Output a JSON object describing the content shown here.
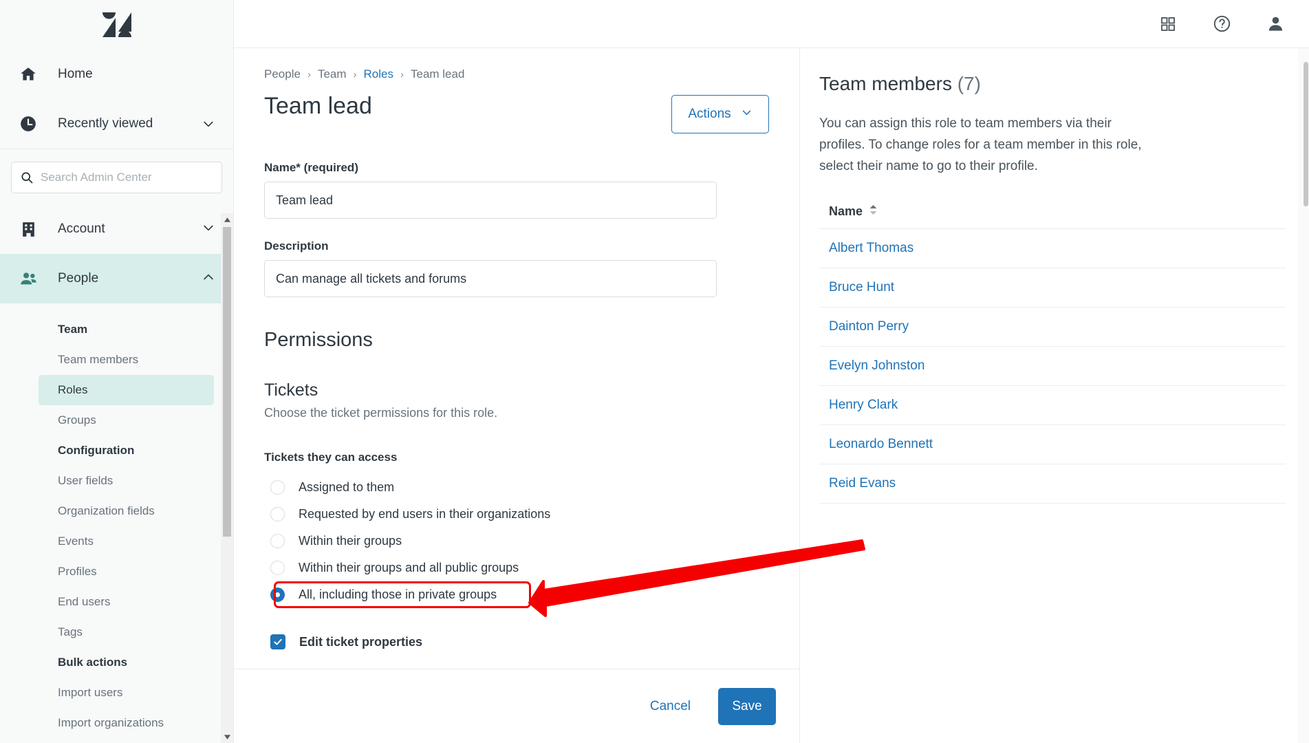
{
  "brand": {
    "logo_name": "zendesk-logo",
    "accent": "#1f73b7",
    "nav_active_bg": "#d7eeea",
    "highlight": "#f50000"
  },
  "sidebar": {
    "top_items": [
      {
        "label": "Home",
        "icon": "home-icon",
        "expandable": false
      },
      {
        "label": "Recently viewed",
        "icon": "clock-icon",
        "expandable": true
      }
    ],
    "search": {
      "placeholder": "Search Admin Center",
      "value": "",
      "icon": "search-icon"
    },
    "sections": [
      {
        "label": "Account",
        "icon": "building-icon",
        "expanded": false
      },
      {
        "label": "People",
        "icon": "people-icon",
        "expanded": true
      }
    ],
    "subnav": [
      {
        "type": "group",
        "label": "Team"
      },
      {
        "type": "item",
        "label": "Team members",
        "active": false
      },
      {
        "type": "item",
        "label": "Roles",
        "active": true
      },
      {
        "type": "item",
        "label": "Groups",
        "active": false
      },
      {
        "type": "group",
        "label": "Configuration"
      },
      {
        "type": "item",
        "label": "User fields",
        "active": false
      },
      {
        "type": "item",
        "label": "Organization fields",
        "active": false
      },
      {
        "type": "item",
        "label": "Events",
        "active": false
      },
      {
        "type": "item",
        "label": "Profiles",
        "active": false
      },
      {
        "type": "item",
        "label": "End users",
        "active": false
      },
      {
        "type": "item",
        "label": "Tags",
        "active": false
      },
      {
        "type": "group",
        "label": "Bulk actions"
      },
      {
        "type": "item",
        "label": "Import users",
        "active": false
      },
      {
        "type": "item",
        "label": "Import organizations",
        "active": false
      }
    ]
  },
  "topbar": {
    "icons": [
      {
        "name": "apps-grid-icon"
      },
      {
        "name": "help-question-icon"
      },
      {
        "name": "user-avatar-icon"
      }
    ]
  },
  "main": {
    "breadcrumb": [
      {
        "label": "People",
        "link": false
      },
      {
        "label": "Team",
        "link": false
      },
      {
        "label": "Roles",
        "link": true
      },
      {
        "label": "Team lead",
        "link": false
      }
    ],
    "breadcrumb_separator": "›",
    "page_title": "Team lead",
    "actions_button": {
      "label": "Actions",
      "icon": "chevron-down-icon"
    },
    "name_field": {
      "label": "Name* (required)",
      "value": "Team lead",
      "placeholder": ""
    },
    "description_field": {
      "label": "Description",
      "value": "Can manage all tickets and forums",
      "placeholder": ""
    },
    "permissions_heading": "Permissions",
    "tickets_heading": "Tickets",
    "tickets_subtext": "Choose the ticket permissions for this role.",
    "access_group_label": "Tickets they can access",
    "access_options": [
      {
        "label": "Assigned to them",
        "selected": false,
        "highlighted": false
      },
      {
        "label": "Requested by end users in their organizations",
        "selected": false,
        "highlighted": false
      },
      {
        "label": "Within their groups",
        "selected": false,
        "highlighted": false
      },
      {
        "label": "Within their groups and all public groups",
        "selected": false,
        "highlighted": false
      },
      {
        "label": "All, including those in private groups",
        "selected": true,
        "highlighted": true
      }
    ],
    "edit_ticket_properties": {
      "label": "Edit ticket properties",
      "checked": true
    }
  },
  "footer": {
    "cancel_label": "Cancel",
    "save_label": "Save"
  },
  "right_panel": {
    "title": "Team members",
    "count": "(7)",
    "description": "You can assign this role to team members via their profiles. To change roles for a team member in this role, select their name to go to their profile.",
    "column_header": "Name",
    "sort_icon": "sort-updown-icon",
    "members": [
      {
        "name": "Albert Thomas"
      },
      {
        "name": "Bruce Hunt"
      },
      {
        "name": "Dainton Perry"
      },
      {
        "name": "Evelyn Johnston"
      },
      {
        "name": "Henry Clark"
      },
      {
        "name": "Leonardo Bennett"
      },
      {
        "name": "Reid Evans"
      }
    ]
  },
  "annotation": {
    "arrow_name": "red-callout-arrow",
    "box_name": "red-highlight-box",
    "color": "#f50000"
  }
}
